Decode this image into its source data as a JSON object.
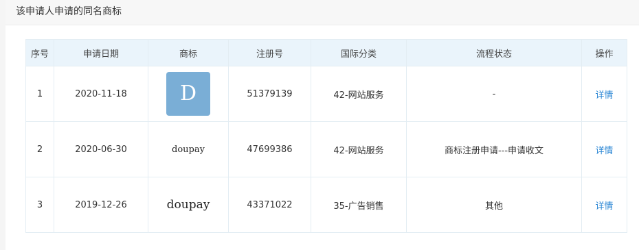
{
  "section": {
    "title": "该申请人申请的同名商标"
  },
  "table": {
    "headers": [
      "序号",
      "申请日期",
      "商标",
      "注册号",
      "国际分类",
      "流程状态",
      "操作"
    ],
    "rows": [
      {
        "index": "1",
        "date": "2020-11-18",
        "mark": "D",
        "mark_style": "logo-box",
        "reg_no": "51379139",
        "class": "42-网站服务",
        "status": "-",
        "action": "详情"
      },
      {
        "index": "2",
        "date": "2020-06-30",
        "mark": "doupay",
        "mark_style": "text-sm",
        "reg_no": "47699386",
        "class": "42-网站服务",
        "status": "商标注册申请---申请收文",
        "action": "详情"
      },
      {
        "index": "3",
        "date": "2019-12-26",
        "mark": "doupay",
        "mark_style": "text-lg",
        "reg_no": "43371022",
        "class": "35-广告销售",
        "status": "其他",
        "action": "详情"
      }
    ]
  },
  "colors": {
    "header_bg": "#eaf4fb",
    "link": "#2a86d4",
    "logo_bg": "#7aaed6"
  }
}
